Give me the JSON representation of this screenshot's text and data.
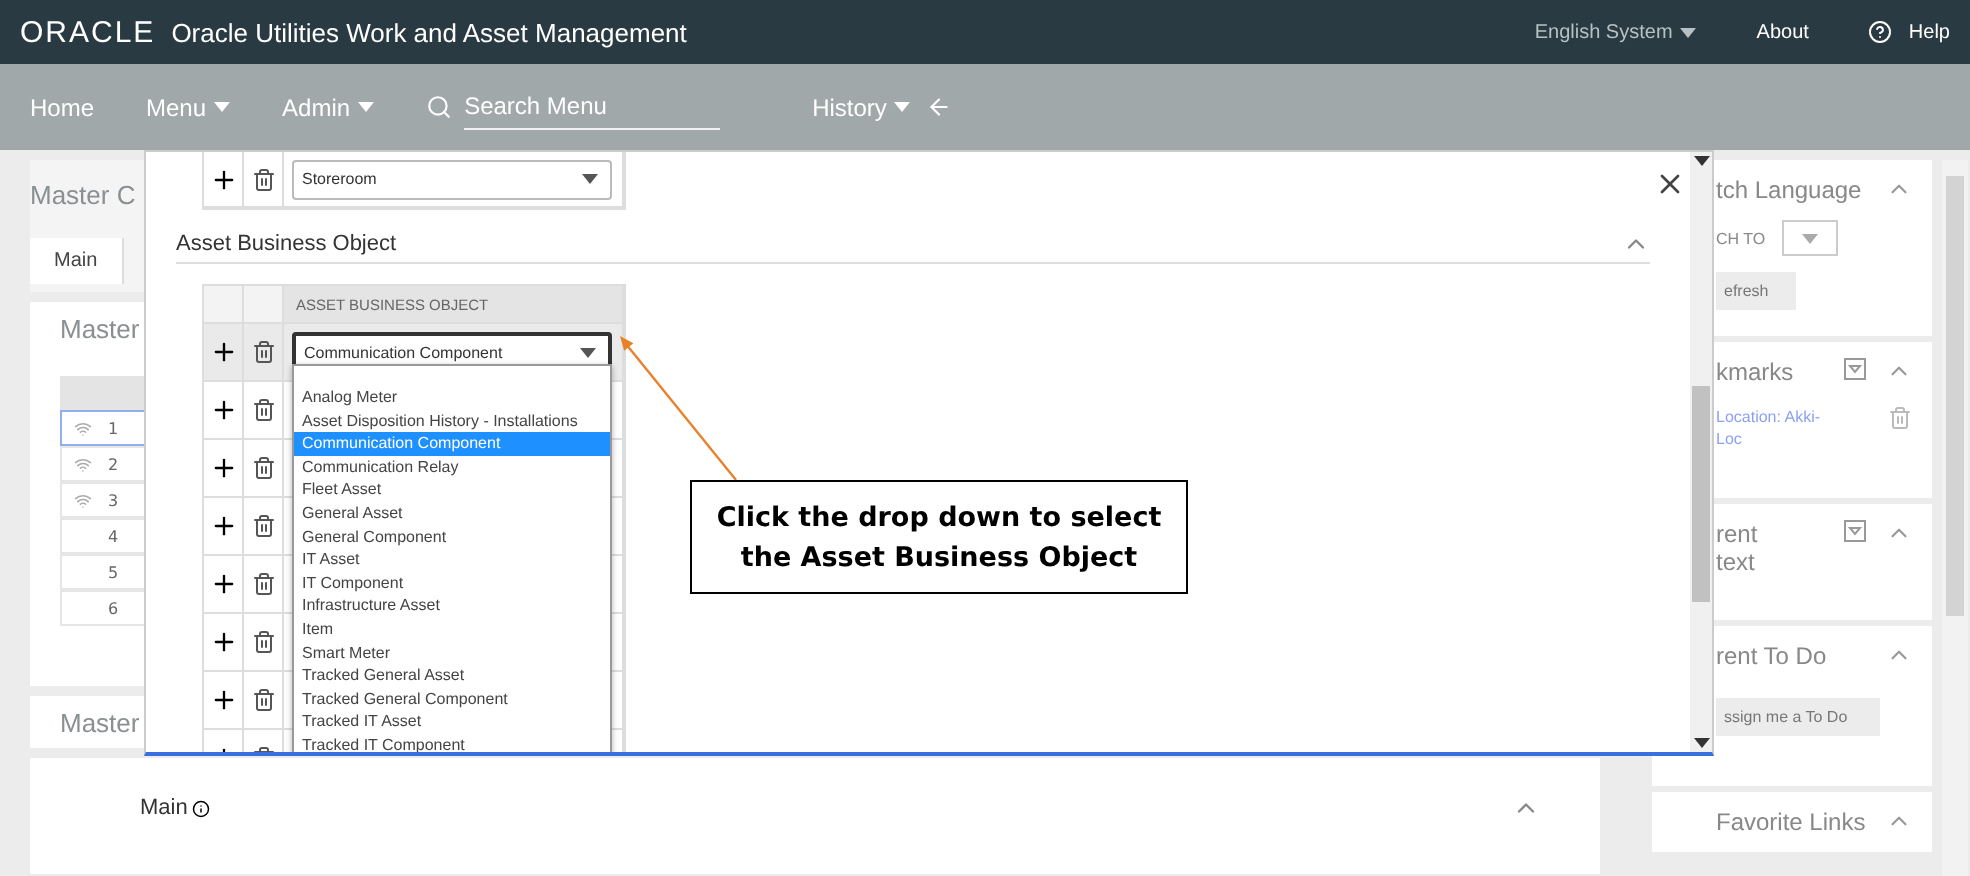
{
  "header": {
    "logo": "ORACLE",
    "title": "Oracle Utilities Work and Asset Management",
    "language": "English System",
    "about": "About",
    "help": "Help"
  },
  "nav": {
    "items": [
      {
        "label": "Home",
        "menu": false
      },
      {
        "label": "Menu",
        "menu": true
      },
      {
        "label": "Admin",
        "menu": true
      }
    ],
    "search": {
      "placeholder": "Search Menu"
    },
    "history": "History"
  },
  "page": {
    "title": "Master C",
    "tab": {
      "label": "Main",
      "selected": true
    },
    "section_1": "Master",
    "rows": [
      {
        "number": "1",
        "connected": true,
        "selected": true
      },
      {
        "number": "2",
        "connected": true,
        "selected": false
      },
      {
        "number": "3",
        "connected": true,
        "selected": false
      },
      {
        "number": "4",
        "connected": false,
        "selected": false
      },
      {
        "number": "5",
        "connected": false,
        "selected": false
      },
      {
        "number": "6",
        "connected": false,
        "selected": false
      }
    ],
    "section_2": "Master",
    "section_3": "Main"
  },
  "sidebar": {
    "panels": [
      {
        "kind": "language",
        "title_lines": [
          "tch Language"
        ],
        "switch_label": "CH TO",
        "button": "efresh"
      },
      {
        "kind": "bookmarks",
        "title_lines": [
          "kmarks"
        ],
        "link_lines": [
          "Location: Akki-",
          "Loc"
        ]
      },
      {
        "kind": "context",
        "title_lines": [
          "rent",
          "text"
        ]
      },
      {
        "kind": "todo",
        "title_lines": [
          "rent To Do"
        ],
        "button": "ssign me a To Do"
      },
      {
        "kind": "links",
        "title_lines": [
          "Favorite Links"
        ]
      }
    ]
  },
  "modal": {
    "top_row": {
      "value": "Storeroom"
    },
    "section": {
      "title": "Asset Business Object",
      "expanded": true
    },
    "table": {
      "column": "ASSET BUSINESS OBJECT",
      "rows": [
        {
          "value": "Communication Component",
          "focused": true
        },
        {
          "focused": false
        },
        {
          "focused": false
        },
        {
          "focused": false
        },
        {
          "focused": false
        },
        {
          "focused": false
        },
        {
          "focused": false
        },
        {
          "focused": false
        }
      ]
    },
    "dropdown": {
      "options": [
        {
          "label": "Analog Meter",
          "selected": false
        },
        {
          "label": "Asset Disposition History - Installations",
          "selected": false
        },
        {
          "label": "Communication Component",
          "selected": true
        },
        {
          "label": "Communication Relay",
          "selected": false
        },
        {
          "label": "Fleet Asset",
          "selected": false
        },
        {
          "label": "General Asset",
          "selected": false
        },
        {
          "label": "General Component",
          "selected": false
        },
        {
          "label": "IT Asset",
          "selected": false
        },
        {
          "label": "IT Component",
          "selected": false
        },
        {
          "label": "Infrastructure Asset",
          "selected": false
        },
        {
          "label": "Item",
          "selected": false
        },
        {
          "label": "Smart Meter",
          "selected": false
        },
        {
          "label": "Tracked General Asset",
          "selected": false
        },
        {
          "label": "Tracked General Component",
          "selected": false
        },
        {
          "label": "Tracked IT Asset",
          "selected": false
        },
        {
          "label": "Tracked IT Component",
          "selected": false
        }
      ]
    }
  },
  "callout": {
    "text": "Click the drop down to select the Asset Business Object"
  }
}
